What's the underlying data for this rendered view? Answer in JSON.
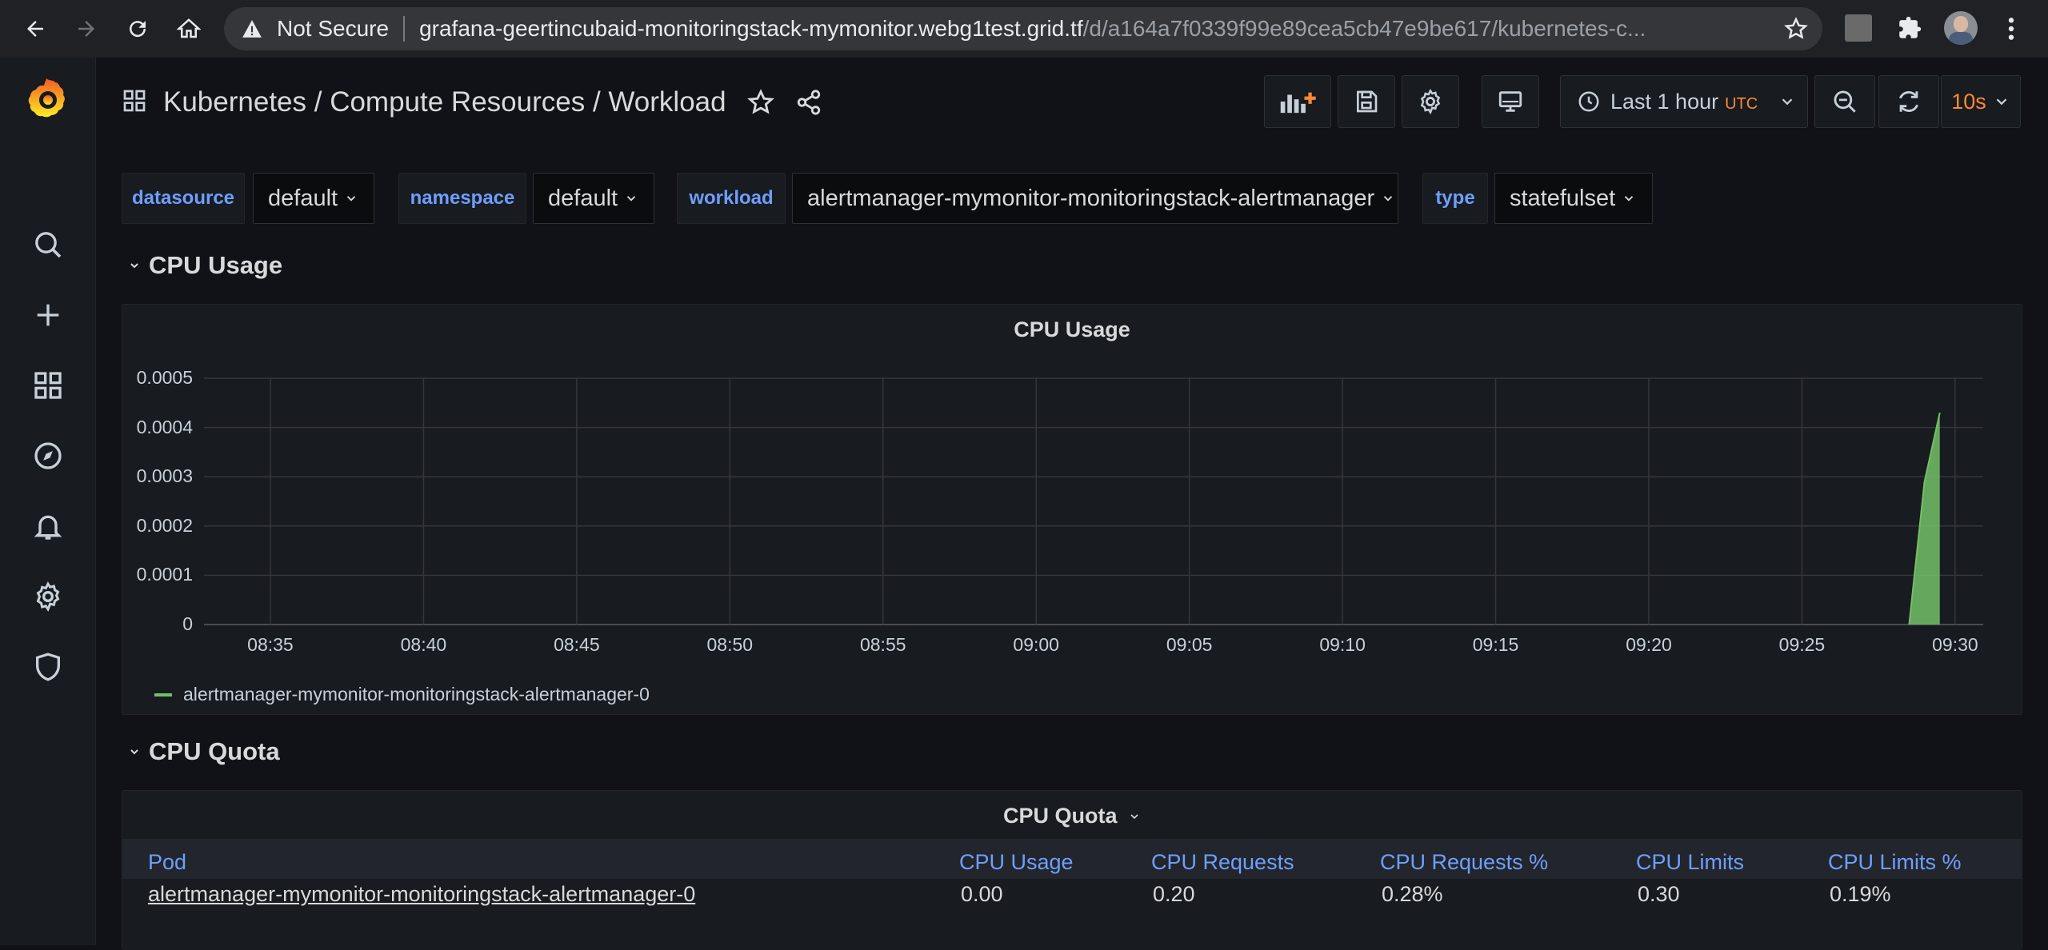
{
  "browser": {
    "security_label": "Not Secure",
    "url_host": "grafana-geertincubaid-monitoringstack-mymonitor.webg1test.grid.tf",
    "url_path": "/d/a164a7f0339f99e89cea5cb47e9be617/kubernetes-c..."
  },
  "header": {
    "breadcrumb": "Kubernetes / Compute Resources / Workload",
    "time_range": "Last 1 hour",
    "timezone": "UTC",
    "refresh_interval": "10s"
  },
  "variables": [
    {
      "label": "datasource",
      "value": "default"
    },
    {
      "label": "namespace",
      "value": "default"
    },
    {
      "label": "workload",
      "value": "alertmanager-mymonitor-monitoringstack-alertmanager"
    },
    {
      "label": "type",
      "value": "statefulset"
    }
  ],
  "rows": {
    "cpu_usage": "CPU Usage",
    "cpu_quota": "CPU Quota"
  },
  "cpu_usage_panel": {
    "title": "CPU Usage",
    "legend": "alertmanager-mymonitor-monitoringstack-alertmanager-0"
  },
  "cpu_quota_panel": {
    "title": "CPU Quota",
    "columns": [
      "Pod",
      "CPU Usage",
      "CPU Requests",
      "CPU Requests %",
      "CPU Limits",
      "CPU Limits %"
    ],
    "rows": [
      [
        "alertmanager-mymonitor-monitoringstack-alertmanager-0",
        "0.00",
        "0.20",
        "0.28%",
        "0.30",
        "0.19%"
      ]
    ]
  },
  "chart_data": {
    "type": "area",
    "title": "CPU Usage",
    "y_ticks": [
      "0.0005",
      "0.0004",
      "0.0003",
      "0.0002",
      "0.0001",
      "0"
    ],
    "x_ticks": [
      "08:35",
      "08:40",
      "08:45",
      "08:50",
      "08:55",
      "09:00",
      "09:05",
      "09:10",
      "09:15",
      "09:20",
      "09:25",
      "09:30"
    ],
    "ylim": [
      0,
      0.0005
    ],
    "series": [
      {
        "name": "alertmanager-mymonitor-monitoringstack-alertmanager-0",
        "color": "#73bf69",
        "x": [
          "09:28:30",
          "09:29:00",
          "09:29:30"
        ],
        "values": [
          0,
          0.00029,
          0.00043
        ]
      }
    ],
    "grid": true,
    "legend_position": "bottom-left"
  }
}
